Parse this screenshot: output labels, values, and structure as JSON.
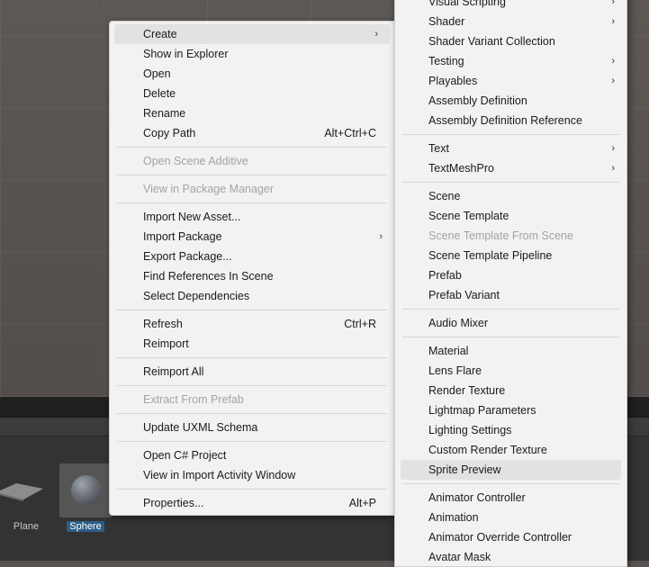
{
  "assets": [
    {
      "name": "Plane"
    },
    {
      "name": "Sphere"
    }
  ],
  "context_menu": {
    "items": [
      {
        "label": "Create"
      },
      {
        "label": "Show in Explorer"
      },
      {
        "label": "Open"
      },
      {
        "label": "Delete"
      },
      {
        "label": "Rename"
      },
      {
        "label": "Copy Path",
        "shortcut": "Alt+Ctrl+C"
      },
      {
        "label": "Open Scene Additive"
      },
      {
        "label": "View in Package Manager"
      },
      {
        "label": "Import New Asset..."
      },
      {
        "label": "Import Package"
      },
      {
        "label": "Export Package..."
      },
      {
        "label": "Find References In Scene"
      },
      {
        "label": "Select Dependencies"
      },
      {
        "label": "Refresh",
        "shortcut": "Ctrl+R"
      },
      {
        "label": "Reimport"
      },
      {
        "label": "Reimport All"
      },
      {
        "label": "Extract From Prefab"
      },
      {
        "label": "Update UXML Schema"
      },
      {
        "label": "Open C# Project"
      },
      {
        "label": "View in Import Activity Window"
      },
      {
        "label": "Properties...",
        "shortcut": "Alt+P"
      }
    ]
  },
  "create_submenu": {
    "items": [
      {
        "label": "Visual Scripting"
      },
      {
        "label": "Shader"
      },
      {
        "label": "Shader Variant Collection"
      },
      {
        "label": "Testing"
      },
      {
        "label": "Playables"
      },
      {
        "label": "Assembly Definition"
      },
      {
        "label": "Assembly Definition Reference"
      },
      {
        "label": "Text"
      },
      {
        "label": "TextMeshPro"
      },
      {
        "label": "Scene"
      },
      {
        "label": "Scene Template"
      },
      {
        "label": "Scene Template From Scene"
      },
      {
        "label": "Scene Template Pipeline"
      },
      {
        "label": "Prefab"
      },
      {
        "label": "Prefab Variant"
      },
      {
        "label": "Audio Mixer"
      },
      {
        "label": "Material"
      },
      {
        "label": "Lens Flare"
      },
      {
        "label": "Render Texture"
      },
      {
        "label": "Lightmap Parameters"
      },
      {
        "label": "Lighting Settings"
      },
      {
        "label": "Custom Render Texture"
      },
      {
        "label": "Sprite Preview"
      },
      {
        "label": "Animator Controller"
      },
      {
        "label": "Animation"
      },
      {
        "label": "Animator Override Controller"
      },
      {
        "label": "Avatar Mask"
      }
    ]
  }
}
